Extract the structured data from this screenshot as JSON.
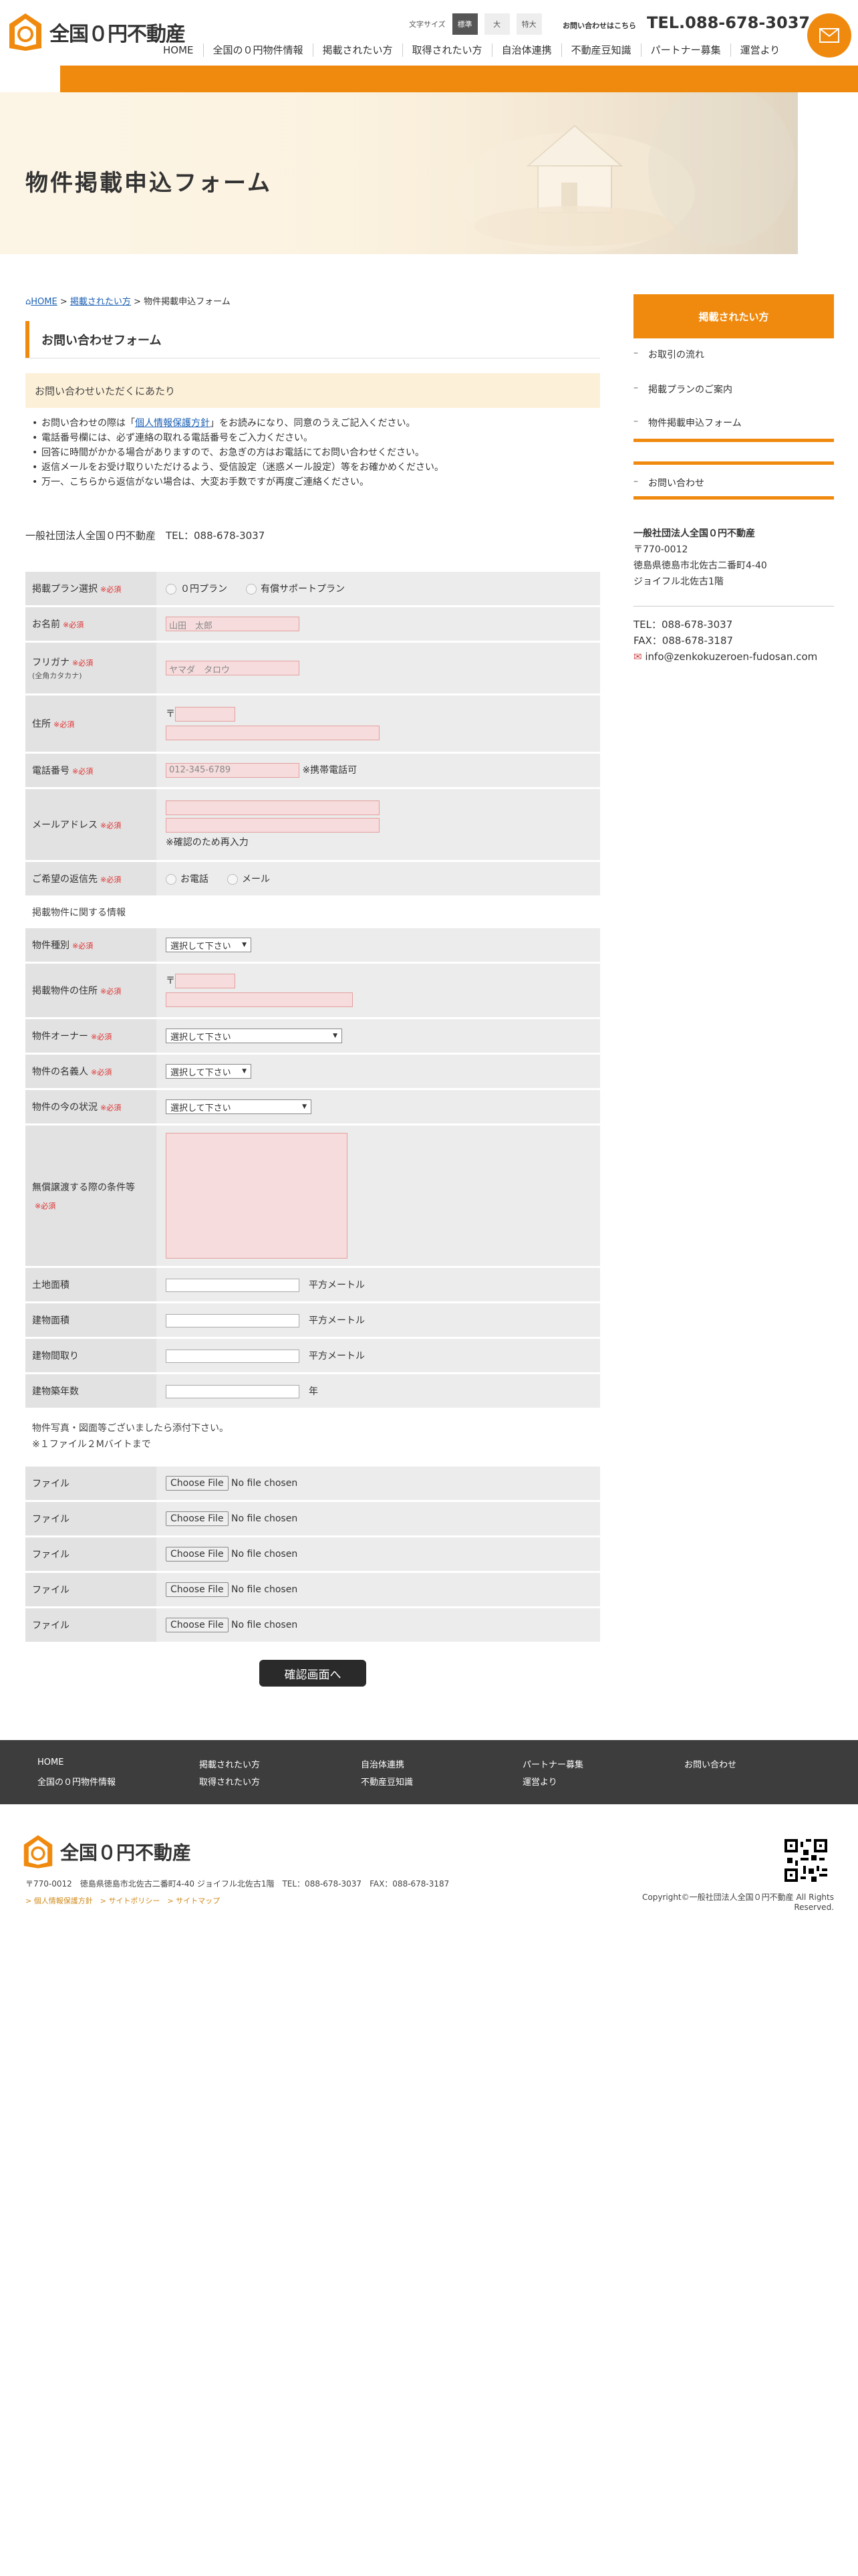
{
  "header": {
    "logo_text": "全国０円不動産",
    "fontsize_label": "文字サイズ",
    "fontsize_options": [
      "標準",
      "大",
      "特大"
    ],
    "contact_label": "お問い合わせはこちら",
    "tel": "TEL.088-678-3037",
    "accent_color": "#f08a0e",
    "nav": [
      "HOME",
      "全国の０円物件情報",
      "掲載されたい方",
      "取得されたい方",
      "自治体連携",
      "不動産豆知識",
      "パートナー募集",
      "運営より"
    ]
  },
  "hero": {
    "title": "物件掲載申込フォーム"
  },
  "breadcrumb": {
    "home": "HOME",
    "parent": "掲載されたい方",
    "current": "物件掲載申込フォーム"
  },
  "section_title": "お問い合わせフォーム",
  "notice": {
    "heading": "お問い合わせいただくにあたり",
    "items": [
      "お問い合わせの際は「個人情報保護方針」をお読みになり、同意のうえご記入ください。",
      "電話番号欄には、必ず連絡の取れる電話番号をご入力ください。",
      "回答に時間がかかる場合がありますので、お急ぎの方はお電話にてお問い合わせください。",
      "返信メールをお受け取りいただけるよう、受信設定（迷惑メール設定）等をお確かめください。",
      "万一、こちらから返信がない場合は、大変お手数ですが再度ご連絡ください。"
    ],
    "item0_pre": "お問い合わせの際は「",
    "item0_link": "個人情報保護方針",
    "item0_post": "」をお読みになり、同意のうえご記入ください。"
  },
  "org_line": "一般社団法人全国０円不動産　TEL：088-678-3037",
  "required_label": "※必須",
  "form": {
    "plan": {
      "label": "掲載プラン選択",
      "options": [
        "０円プラン",
        "有償サポートプラン"
      ]
    },
    "name": {
      "label": "お名前",
      "placeholder": "山田　太郎"
    },
    "kana": {
      "label": "フリガナ",
      "sub": "(全角カタカナ)",
      "placeholder": "ヤマダ　タロウ"
    },
    "address": {
      "label": "住所",
      "zip_mark": "〒"
    },
    "phone": {
      "label": "電話番号",
      "placeholder": "012-345-6789",
      "note": "※携帯電話可"
    },
    "email": {
      "label": "メールアドレス",
      "note": "※確認のため再入力"
    },
    "reply": {
      "label": "ご希望の返信先",
      "options": [
        "お電話",
        "メール"
      ]
    },
    "property_section": "掲載物件に関する情報",
    "ptype": {
      "label": "物件種別",
      "value": "選択して下さい"
    },
    "paddress": {
      "label": "掲載物件の住所",
      "zip_mark": "〒"
    },
    "owner": {
      "label": "物件オーナー",
      "value": "選択して下さい"
    },
    "nominee": {
      "label": "物件の名義人",
      "value": "選択して下さい"
    },
    "status": {
      "label": "物件の今の状況",
      "value": "選択して下さい"
    },
    "conditions": {
      "label": "無償譲渡する際の条件等"
    },
    "land_area": {
      "label": "土地面積",
      "unit": "平方メートル"
    },
    "building_area": {
      "label": "建物面積",
      "unit": "平方メートル"
    },
    "layout": {
      "label": "建物間取り",
      "unit": "平方メートル"
    },
    "age": {
      "label": "建物築年数",
      "unit": "年"
    },
    "photo_note1": "物件写真・図面等ございましたら添付下さい。",
    "photo_note2": "※１ファイル２Mバイトまで",
    "file_label": "ファイル",
    "file_button": "Choose File",
    "file_status": "No file chosen",
    "confirm_button": "確認画面へ"
  },
  "sidebar": {
    "heading": "掲載されたい方",
    "items": [
      "お取引の流れ",
      "掲載プランのご案内",
      "物件掲載申込フォーム"
    ],
    "contact_item": "お問い合わせ",
    "org_name": "一般社団法人全国０円不動産",
    "zip": "〒770-0012",
    "address1": "徳島県徳島市北佐古二番町4-40",
    "address2": "ジョイフル北佐古1階",
    "tel": "TEL：088-678-3037",
    "fax": "FAX：088-678-3187",
    "email": "info@zenkokuzeroen-fudosan.com"
  },
  "footer": {
    "nav": [
      "HOME",
      "掲載されたい方",
      "自治体連携",
      "パートナー募集",
      "お問い合わせ",
      "全国の０円物件情報",
      "取得されたい方",
      "不動産豆知識",
      "運営より"
    ],
    "logo_text": "全国０円不動産",
    "address": "〒770-0012　徳島県徳島市北佐古二番町4-40 ジョイフル北佐古1階　TEL：088-678-3037　FAX：088-678-3187",
    "links": [
      "個人情報保護方針",
      "サイトポリシー",
      "サイトマップ"
    ],
    "copyright": "Copyright©一般社団法人全国０円不動産 All Rights Reserved."
  }
}
